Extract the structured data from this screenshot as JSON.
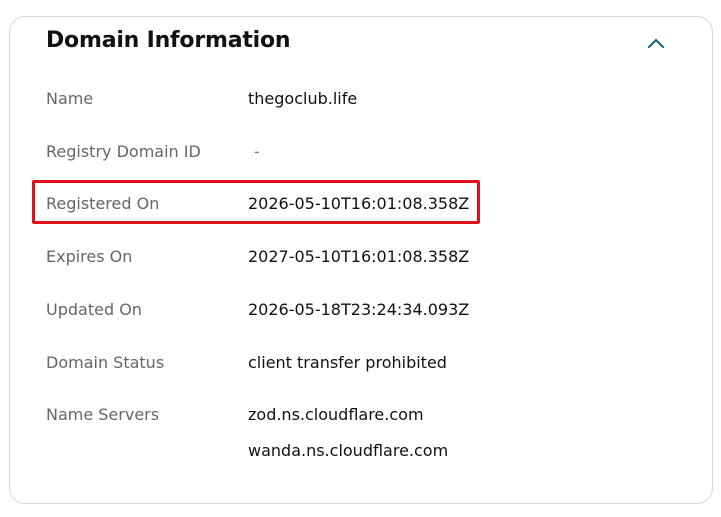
{
  "card": {
    "title": "Domain Information",
    "collapse_icon": "chevron-up-icon",
    "accent_color": "#1a6b7c",
    "highlight_color": "#e0101a"
  },
  "rows": {
    "name": {
      "label": "Name",
      "value": "thegoclub.life"
    },
    "registry_domain_id": {
      "label": "Registry Domain ID",
      "value": "-"
    },
    "registered_on": {
      "label": "Registered On",
      "value": "2026-05-10T16:01:08.358Z"
    },
    "expires_on": {
      "label": "Expires On",
      "value": "2027-05-10T16:01:08.358Z"
    },
    "updated_on": {
      "label": "Updated On",
      "value": "2026-05-18T23:24:34.093Z"
    },
    "domain_status": {
      "label": "Domain Status",
      "value": "client transfer prohibited"
    },
    "name_servers": {
      "label": "Name Servers",
      "values": [
        "zod.ns.cloudflare.com",
        "wanda.ns.cloudflare.com"
      ]
    }
  }
}
